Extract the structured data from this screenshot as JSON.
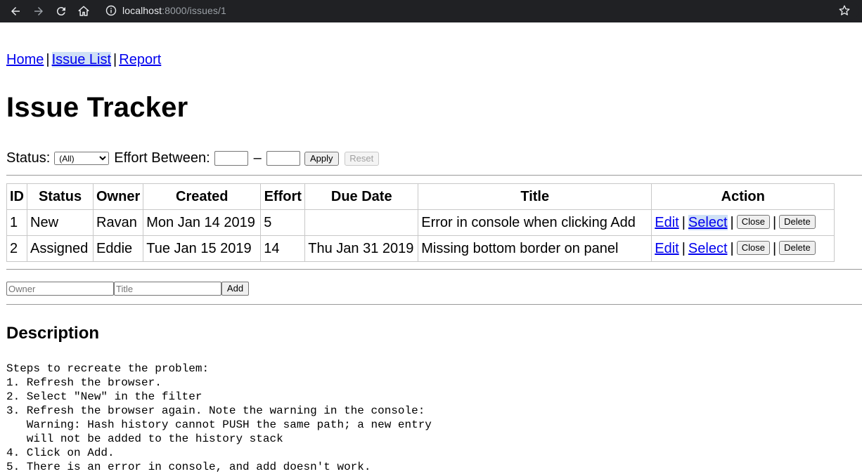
{
  "browser": {
    "url_host": "localhost",
    "url_rest": ":8000/issues/1"
  },
  "nav": {
    "home": "Home",
    "issue_list": "Issue List",
    "report": "Report",
    "sep": "|"
  },
  "page_title": "Issue Tracker",
  "filter": {
    "status_label": "Status:",
    "status_selected": "(All)",
    "effort_label": "Effort Between:",
    "dash": "–",
    "apply_label": "Apply",
    "reset_label": "Reset"
  },
  "table": {
    "headers": [
      "ID",
      "Status",
      "Owner",
      "Created",
      "Effort",
      "Due Date",
      "Title",
      "Action"
    ],
    "rows": [
      {
        "id": "1",
        "status": "New",
        "owner": "Ravan",
        "created": "Mon Jan 14 2019",
        "effort": "5",
        "due": "",
        "title": "Error in console when clicking Add"
      },
      {
        "id": "2",
        "status": "Assigned",
        "owner": "Eddie",
        "created": "Tue Jan 15 2019",
        "effort": "14",
        "due": "Thu Jan 31 2019",
        "title": "Missing bottom border on panel"
      }
    ],
    "actions": {
      "edit": "Edit",
      "select": "Select",
      "close": "Close",
      "delete": "Delete",
      "sep": "|"
    }
  },
  "add_form": {
    "owner_placeholder": "Owner",
    "title_placeholder": "Title",
    "add_label": "Add"
  },
  "description": {
    "title": "Description",
    "text": "Steps to recreate the problem:\n1. Refresh the browser.\n2. Select \"New\" in the filter\n3. Refresh the browser again. Note the warning in the console:\n   Warning: Hash history cannot PUSH the same path; a new entry\n   will not be added to the history stack\n4. Click on Add.\n5. There is an error in console, and add doesn't work."
  }
}
